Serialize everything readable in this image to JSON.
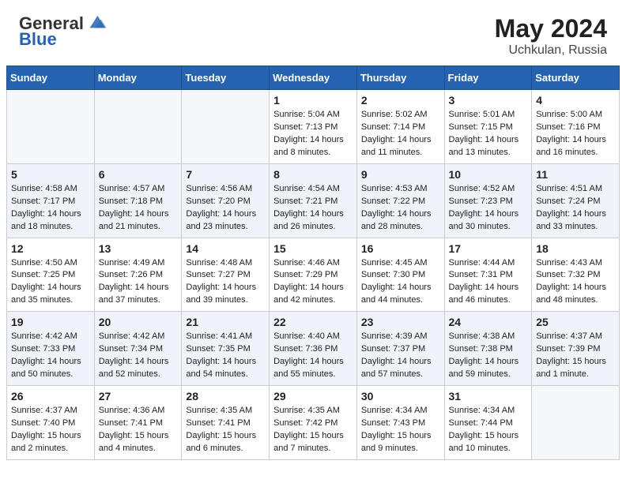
{
  "header": {
    "logo_general": "General",
    "logo_blue": "Blue",
    "month_year": "May 2024",
    "location": "Uchkulan, Russia"
  },
  "weekdays": [
    "Sunday",
    "Monday",
    "Tuesday",
    "Wednesday",
    "Thursday",
    "Friday",
    "Saturday"
  ],
  "weeks": [
    [
      {
        "day": "",
        "content": ""
      },
      {
        "day": "",
        "content": ""
      },
      {
        "day": "",
        "content": ""
      },
      {
        "day": "1",
        "content": "Sunrise: 5:04 AM\nSunset: 7:13 PM\nDaylight: 14 hours\nand 8 minutes."
      },
      {
        "day": "2",
        "content": "Sunrise: 5:02 AM\nSunset: 7:14 PM\nDaylight: 14 hours\nand 11 minutes."
      },
      {
        "day": "3",
        "content": "Sunrise: 5:01 AM\nSunset: 7:15 PM\nDaylight: 14 hours\nand 13 minutes."
      },
      {
        "day": "4",
        "content": "Sunrise: 5:00 AM\nSunset: 7:16 PM\nDaylight: 14 hours\nand 16 minutes."
      }
    ],
    [
      {
        "day": "5",
        "content": "Sunrise: 4:58 AM\nSunset: 7:17 PM\nDaylight: 14 hours\nand 18 minutes."
      },
      {
        "day": "6",
        "content": "Sunrise: 4:57 AM\nSunset: 7:18 PM\nDaylight: 14 hours\nand 21 minutes."
      },
      {
        "day": "7",
        "content": "Sunrise: 4:56 AM\nSunset: 7:20 PM\nDaylight: 14 hours\nand 23 minutes."
      },
      {
        "day": "8",
        "content": "Sunrise: 4:54 AM\nSunset: 7:21 PM\nDaylight: 14 hours\nand 26 minutes."
      },
      {
        "day": "9",
        "content": "Sunrise: 4:53 AM\nSunset: 7:22 PM\nDaylight: 14 hours\nand 28 minutes."
      },
      {
        "day": "10",
        "content": "Sunrise: 4:52 AM\nSunset: 7:23 PM\nDaylight: 14 hours\nand 30 minutes."
      },
      {
        "day": "11",
        "content": "Sunrise: 4:51 AM\nSunset: 7:24 PM\nDaylight: 14 hours\nand 33 minutes."
      }
    ],
    [
      {
        "day": "12",
        "content": "Sunrise: 4:50 AM\nSunset: 7:25 PM\nDaylight: 14 hours\nand 35 minutes."
      },
      {
        "day": "13",
        "content": "Sunrise: 4:49 AM\nSunset: 7:26 PM\nDaylight: 14 hours\nand 37 minutes."
      },
      {
        "day": "14",
        "content": "Sunrise: 4:48 AM\nSunset: 7:27 PM\nDaylight: 14 hours\nand 39 minutes."
      },
      {
        "day": "15",
        "content": "Sunrise: 4:46 AM\nSunset: 7:29 PM\nDaylight: 14 hours\nand 42 minutes."
      },
      {
        "day": "16",
        "content": "Sunrise: 4:45 AM\nSunset: 7:30 PM\nDaylight: 14 hours\nand 44 minutes."
      },
      {
        "day": "17",
        "content": "Sunrise: 4:44 AM\nSunset: 7:31 PM\nDaylight: 14 hours\nand 46 minutes."
      },
      {
        "day": "18",
        "content": "Sunrise: 4:43 AM\nSunset: 7:32 PM\nDaylight: 14 hours\nand 48 minutes."
      }
    ],
    [
      {
        "day": "19",
        "content": "Sunrise: 4:42 AM\nSunset: 7:33 PM\nDaylight: 14 hours\nand 50 minutes."
      },
      {
        "day": "20",
        "content": "Sunrise: 4:42 AM\nSunset: 7:34 PM\nDaylight: 14 hours\nand 52 minutes."
      },
      {
        "day": "21",
        "content": "Sunrise: 4:41 AM\nSunset: 7:35 PM\nDaylight: 14 hours\nand 54 minutes."
      },
      {
        "day": "22",
        "content": "Sunrise: 4:40 AM\nSunset: 7:36 PM\nDaylight: 14 hours\nand 55 minutes."
      },
      {
        "day": "23",
        "content": "Sunrise: 4:39 AM\nSunset: 7:37 PM\nDaylight: 14 hours\nand 57 minutes."
      },
      {
        "day": "24",
        "content": "Sunrise: 4:38 AM\nSunset: 7:38 PM\nDaylight: 14 hours\nand 59 minutes."
      },
      {
        "day": "25",
        "content": "Sunrise: 4:37 AM\nSunset: 7:39 PM\nDaylight: 15 hours\nand 1 minute."
      }
    ],
    [
      {
        "day": "26",
        "content": "Sunrise: 4:37 AM\nSunset: 7:40 PM\nDaylight: 15 hours\nand 2 minutes."
      },
      {
        "day": "27",
        "content": "Sunrise: 4:36 AM\nSunset: 7:41 PM\nDaylight: 15 hours\nand 4 minutes."
      },
      {
        "day": "28",
        "content": "Sunrise: 4:35 AM\nSunset: 7:41 PM\nDaylight: 15 hours\nand 6 minutes."
      },
      {
        "day": "29",
        "content": "Sunrise: 4:35 AM\nSunset: 7:42 PM\nDaylight: 15 hours\nand 7 minutes."
      },
      {
        "day": "30",
        "content": "Sunrise: 4:34 AM\nSunset: 7:43 PM\nDaylight: 15 hours\nand 9 minutes."
      },
      {
        "day": "31",
        "content": "Sunrise: 4:34 AM\nSunset: 7:44 PM\nDaylight: 15 hours\nand 10 minutes."
      },
      {
        "day": "",
        "content": ""
      }
    ]
  ]
}
